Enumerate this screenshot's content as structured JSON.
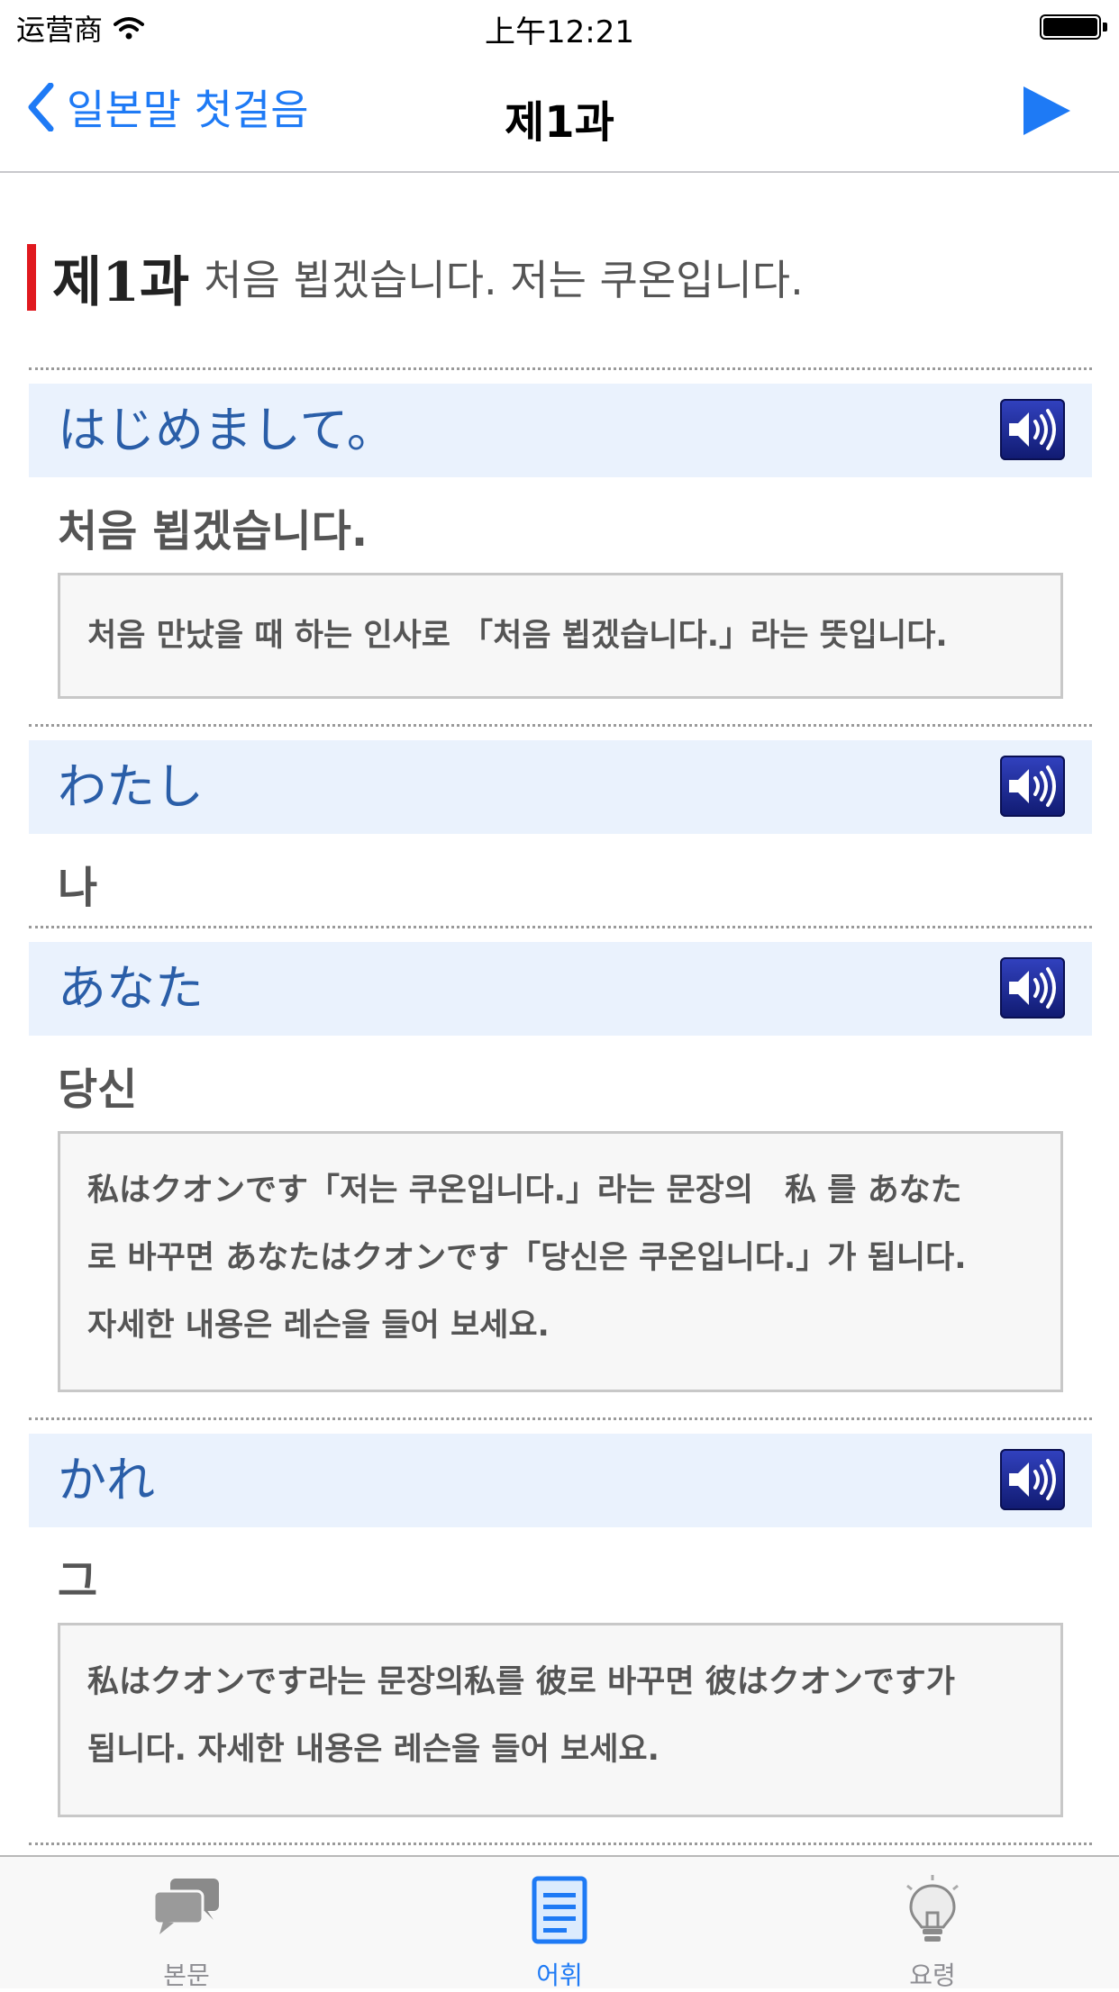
{
  "status": {
    "carrier": "运营商",
    "time": "上午12:21"
  },
  "nav": {
    "back_label": "일본말 첫걸음",
    "title": "제1과"
  },
  "lesson": {
    "number": "제1과",
    "subtitle": "처음 뵙겠습니다. 저는 쿠온입니다."
  },
  "words": [
    {
      "jp": "はじめまして。",
      "ko": "처음 뵙겠습니다.",
      "note": [
        "처음 만났을 때 하는 인사로 「처음 뵙겠습니다.」라는 뜻입니다."
      ]
    },
    {
      "jp": "わたし",
      "ko": "나"
    },
    {
      "jp": "あなた",
      "ko": "당신",
      "note": [
        "私はクオンです「저는 쿠온입니다.」라는 문장의　私 를 あなた",
        "로 바꾸면 あなたはクオンです「당신은 쿠온입니다.」가 됩니다.",
        "자세한 내용은 레슨을 들어 보세요."
      ]
    },
    {
      "jp": "かれ",
      "ko": "그",
      "note": [
        "私はクオンです라는 문장의私를 彼로 바꾸면 彼はクオンです가",
        "됩니다. 자세한 내용은 레슨을 들어 보세요."
      ]
    }
  ],
  "tabs": [
    {
      "label": "본문",
      "icon": "chat-bubbles-icon",
      "active": false
    },
    {
      "label": "어휘",
      "icon": "document-icon",
      "active": true
    },
    {
      "label": "요령",
      "icon": "lightbulb-icon",
      "active": false
    }
  ],
  "colors": {
    "accent": "#1e7af5",
    "lesson_bar": "#e0191f",
    "word_bg": "#eaf2fd",
    "word_text": "#2a5ea8"
  }
}
